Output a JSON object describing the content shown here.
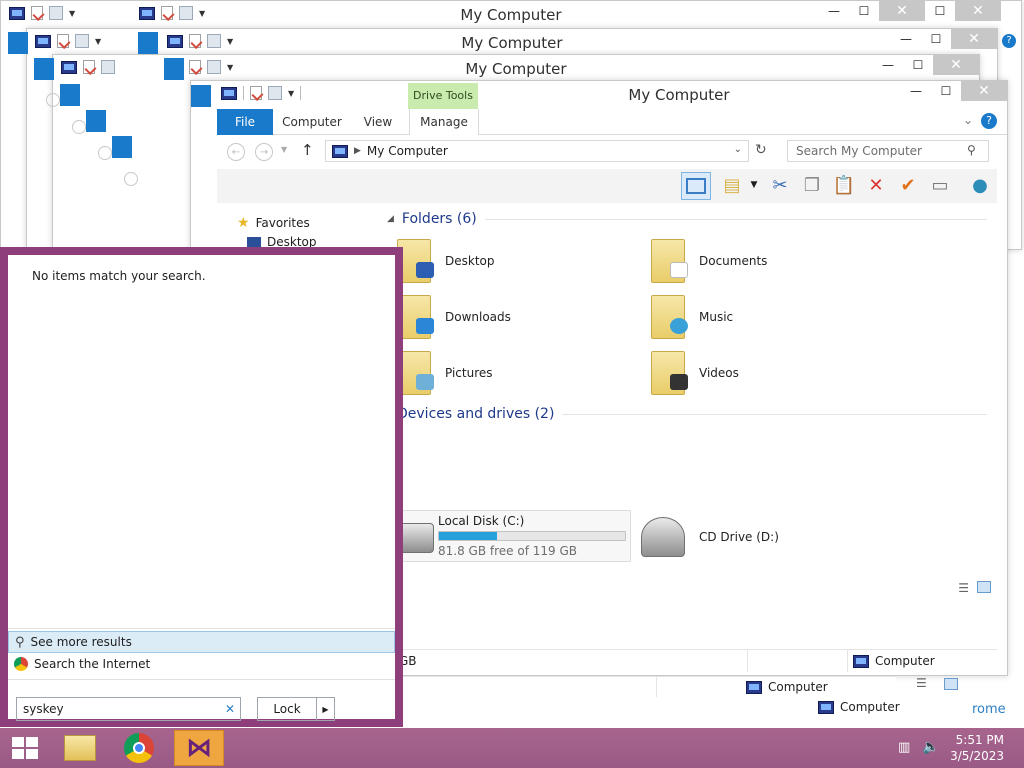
{
  "window_title": "My Computer",
  "ribbon": {
    "drive_tools": "Drive Tools",
    "tabs": [
      "File",
      "Computer",
      "View",
      "Manage"
    ]
  },
  "address": {
    "path": "My Computer",
    "search_placeholder": "Search My Computer"
  },
  "nav_pane": {
    "favorites": "Favorites",
    "desktop": "Desktop"
  },
  "folders": {
    "header": "Folders (6)",
    "items": [
      "Desktop",
      "Documents",
      "Downloads",
      "Music",
      "Pictures",
      "Videos"
    ]
  },
  "devices": {
    "header": "Devices and drives (2)",
    "local_disk": {
      "name": "Local Disk (C:)",
      "free_text": "81.8 GB free of 119 GB",
      "used_fraction": 0.31
    },
    "cd_drive": "CD Drive (D:)"
  },
  "status": {
    "left": "GB",
    "right": "Computer",
    "behind_1": "Computer",
    "behind_2": "Computer",
    "behind_partial": "rome"
  },
  "search_panel": {
    "no_items": "No items match your search.",
    "see_more": "See more results",
    "search_internet": "Search the Internet",
    "query": "syskey",
    "lock_label": "Lock"
  },
  "tray": {
    "time": "5:51 PM",
    "date": "3/5/2023"
  },
  "colors": {
    "accent": "#1979ca",
    "start_panel": "#8d3e7b",
    "taskbar": "#a7658d"
  }
}
